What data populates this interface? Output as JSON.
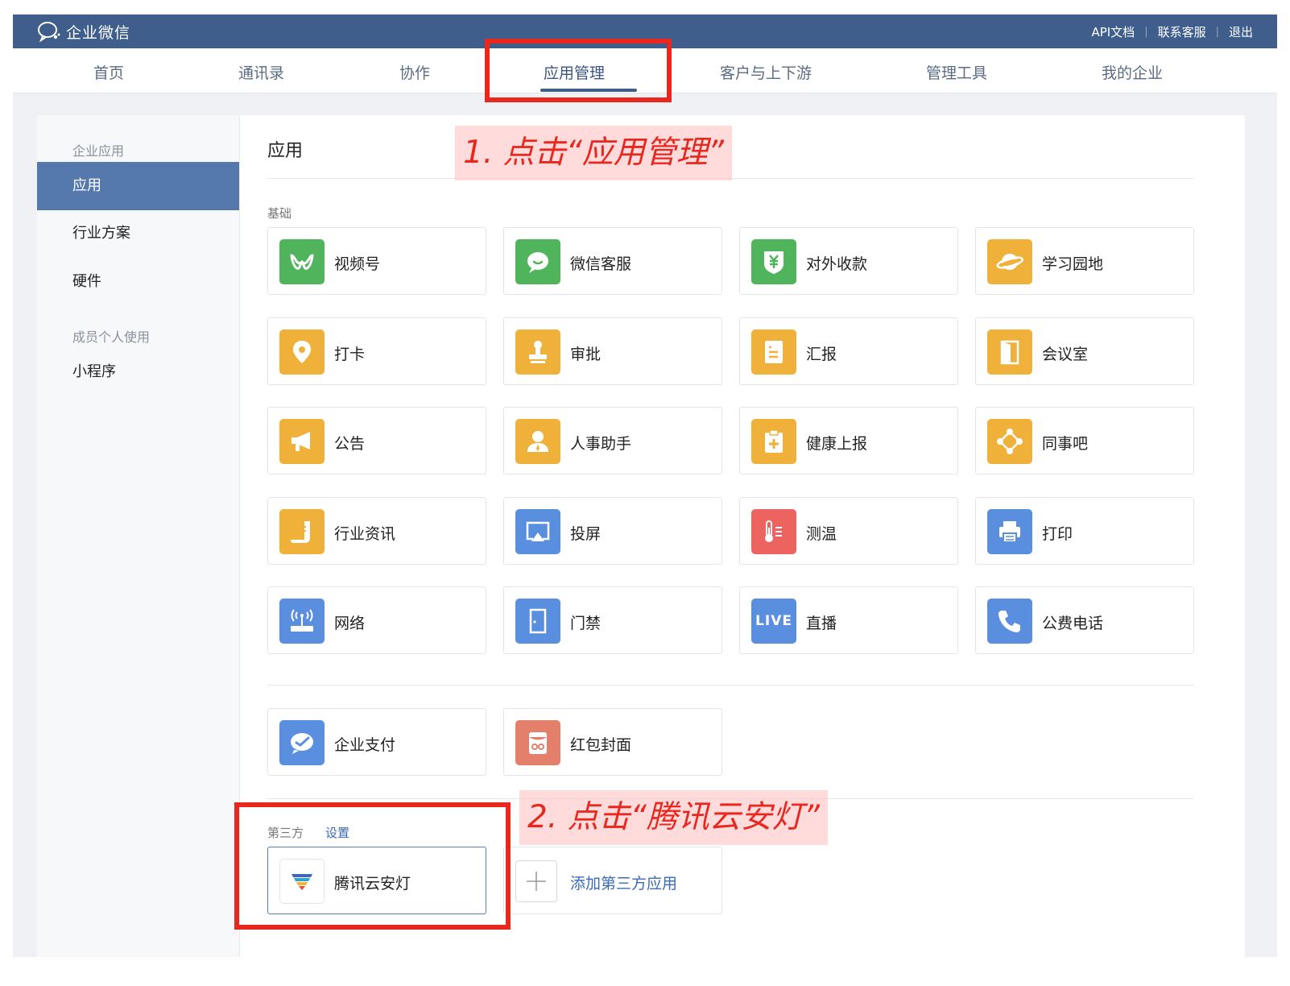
{
  "header": {
    "logo_text": "企业微信",
    "links": [
      "API文档",
      "联系客服",
      "退出"
    ],
    "separators": [
      "|",
      "|"
    ]
  },
  "nav": {
    "items": [
      {
        "label": "首页"
      },
      {
        "label": "通讯录"
      },
      {
        "label": "协作"
      },
      {
        "label": "应用管理",
        "active": true
      },
      {
        "label": "客户与上下游"
      },
      {
        "label": "管理工具"
      },
      {
        "label": "我的企业"
      }
    ]
  },
  "sidebar": {
    "group1": "企业应用",
    "items1": [
      {
        "label": "应用",
        "active": true
      },
      {
        "label": "行业方案"
      },
      {
        "label": "硬件"
      }
    ],
    "group2": "成员个人使用",
    "items2": [
      {
        "label": "小程序"
      }
    ]
  },
  "main": {
    "title": "应用",
    "basic_label": "基础",
    "apps": [
      {
        "label": "视频号",
        "icon": "channels-icon",
        "color": "#4fb45c"
      },
      {
        "label": "微信客服",
        "icon": "chat-bubble-icon",
        "color": "#4fb45c"
      },
      {
        "label": "对外收款",
        "icon": "yuan-shield-icon",
        "color": "#4fb45c"
      },
      {
        "label": "学习园地",
        "icon": "planet-icon",
        "color": "#f0b13a"
      },
      {
        "label": "打卡",
        "icon": "location-pin-icon",
        "color": "#f0b13a"
      },
      {
        "label": "审批",
        "icon": "stamp-icon",
        "color": "#f0b13a"
      },
      {
        "label": "汇报",
        "icon": "report-document-icon",
        "color": "#f0b13a"
      },
      {
        "label": "会议室",
        "icon": "door-icon",
        "color": "#f0b13a"
      },
      {
        "label": "公告",
        "icon": "megaphone-icon",
        "color": "#f0b13a"
      },
      {
        "label": "人事助手",
        "icon": "person-icon",
        "color": "#f0b13a"
      },
      {
        "label": "健康上报",
        "icon": "clipboard-plus-icon",
        "color": "#f0b13a"
      },
      {
        "label": "同事吧",
        "icon": "network-nodes-icon",
        "color": "#f0b13a"
      },
      {
        "label": "行业资讯",
        "icon": "news-scroll-icon",
        "color": "#f0b13a"
      },
      {
        "label": "投屏",
        "icon": "screen-cast-icon",
        "color": "#5a8fe0"
      },
      {
        "label": "测温",
        "icon": "thermometer-icon",
        "color": "#ec6360"
      },
      {
        "label": "打印",
        "icon": "printer-icon",
        "color": "#5a8fe0"
      },
      {
        "label": "网络",
        "icon": "wifi-router-icon",
        "color": "#5a8fe0"
      },
      {
        "label": "门禁",
        "icon": "door-access-icon",
        "color": "#5a8fe0"
      },
      {
        "label": "直播",
        "icon": "live-icon",
        "icon_text": "LIVE",
        "color": "#5a8fe0"
      },
      {
        "label": "公费电话",
        "icon": "phone-icon",
        "color": "#5a8fe0"
      }
    ],
    "extra_apps": [
      {
        "label": "企业支付",
        "icon": "payment-check-icon",
        "color": "#5a8fe0"
      },
      {
        "label": "红包封面",
        "icon": "red-packet-icon",
        "color": "#e47f6b"
      }
    ],
    "third_party_label": "第三方",
    "settings_label": "设置",
    "third_party_apps": [
      {
        "label": "腾讯云安灯",
        "icon": "funnel-icon"
      }
    ],
    "add_third_party_label": "添加第三方应用"
  },
  "annotations": {
    "step1": "1. 点击“应用管理”",
    "step2": "2. 点击“腾讯云安灯”",
    "color": "#e8271e"
  }
}
